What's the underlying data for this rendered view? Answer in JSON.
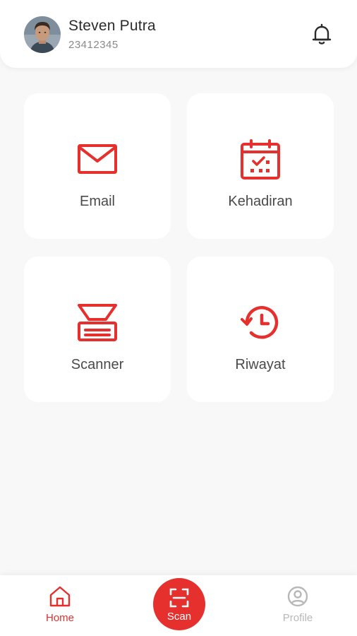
{
  "user": {
    "name": "Steven Putra",
    "id": "23412345"
  },
  "menu": [
    {
      "label": "Email",
      "icon": "envelope-icon"
    },
    {
      "label": "Kehadiran",
      "icon": "calendar-check-icon"
    },
    {
      "label": "Scanner",
      "icon": "scanner-icon"
    },
    {
      "label": "Riwayat",
      "icon": "history-icon"
    }
  ],
  "nav": {
    "home": "Home",
    "scan": "Scan",
    "profile": "Profile"
  },
  "colors": {
    "accent": "#e5302d",
    "inactive": "#b8b8b8",
    "background": "#f8f8f8"
  }
}
